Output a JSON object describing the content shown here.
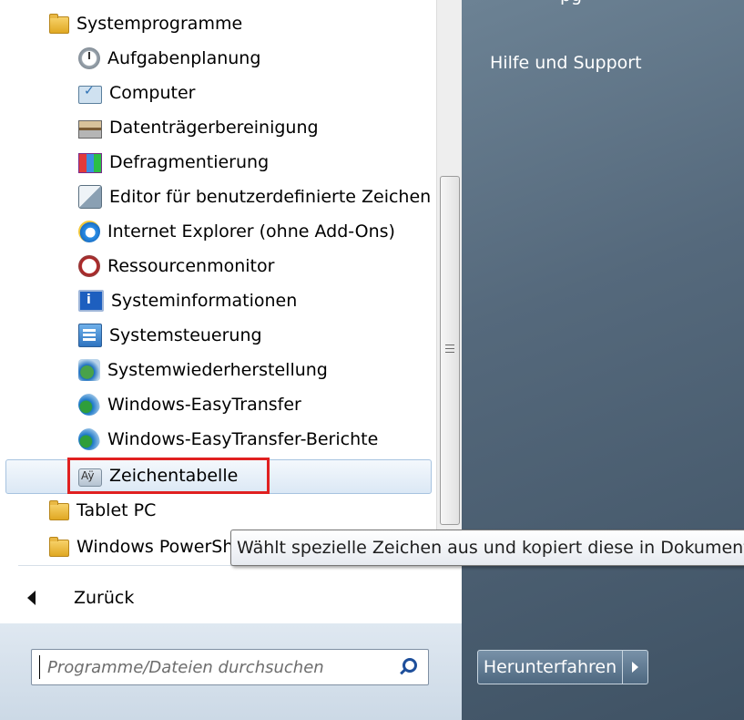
{
  "programs": {
    "folder_system": "Systemprogramme",
    "items": [
      {
        "label": "Aufgabenplanung",
        "icon": "clock-icon"
      },
      {
        "label": "Computer",
        "icon": "computer-icon"
      },
      {
        "label": "Datenträgerbereinigung",
        "icon": "disk-cleanup-icon"
      },
      {
        "label": "Defragmentierung",
        "icon": "defrag-icon"
      },
      {
        "label": "Editor für benutzerdefinierte Zeichen",
        "icon": "char-editor-icon"
      },
      {
        "label": "Internet Explorer (ohne Add-Ons)",
        "icon": "internet-explorer-icon"
      },
      {
        "label": "Ressourcenmonitor",
        "icon": "resource-monitor-icon"
      },
      {
        "label": "Systeminformationen",
        "icon": "system-info-icon"
      },
      {
        "label": "Systemsteuerung",
        "icon": "control-panel-icon"
      },
      {
        "label": "Systemwiederherstellung",
        "icon": "system-restore-icon"
      },
      {
        "label": "Windows-EasyTransfer",
        "icon": "easy-transfer-icon"
      },
      {
        "label": "Windows-EasyTransfer-Berichte",
        "icon": "easy-transfer-reports-icon"
      },
      {
        "label": "Zeichentabelle",
        "icon": "character-map-icon"
      }
    ],
    "folder_tablet": "Tablet PC",
    "folder_powershell": "Windows PowerShell"
  },
  "back_label": "Zurück",
  "search": {
    "placeholder": "Programme/Dateien durchsuchen"
  },
  "right": {
    "top_cut": "pg",
    "help": "Hilfe und Support",
    "shutdown": "Herunterfahren"
  },
  "tooltip": "Wählt spezielle Zeichen aus und kopiert diese in Dokumente.",
  "colors": {
    "highlight_box": "#e02020",
    "right_pane": "#55697c"
  }
}
